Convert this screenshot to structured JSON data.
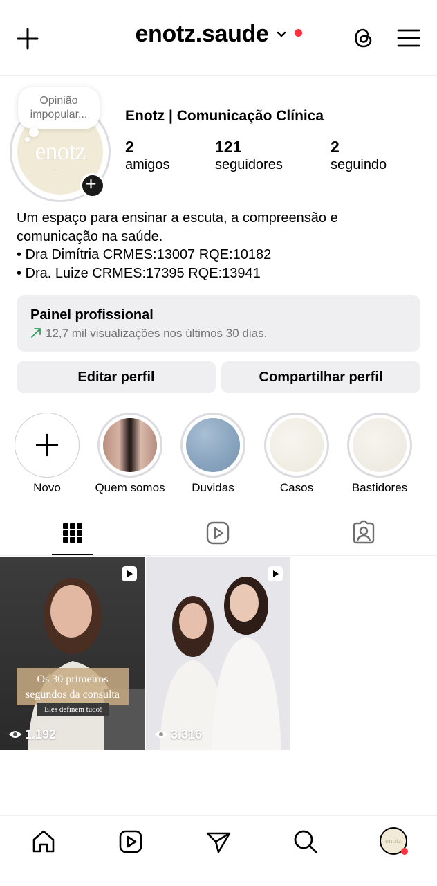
{
  "header": {
    "username": "enotz.saude",
    "icons": [
      "plus-icon",
      "chevron-down-icon",
      "threads-icon",
      "menu-icon"
    ],
    "notification_color": "#ff3040"
  },
  "profile": {
    "note": "Opinião impopular...",
    "avatar_text": "enotz",
    "display_name": "Enotz | Comunicação Clínica",
    "stats": [
      {
        "value": "2",
        "label": "amigos"
      },
      {
        "value": "121",
        "label": "seguidores"
      },
      {
        "value": "2",
        "label": "seguindo"
      }
    ],
    "bio": [
      "Um espaço para ensinar a escuta, a compreensão e",
      "comunicação na saúde.",
      "• Dra Dimítria CRMES:13007 RQE:10182",
      "• Dra. Luize CRMES:17395 RQE:13941"
    ]
  },
  "dashboard": {
    "title": "Painel profissional",
    "subtitle": "12,7 mil visualizações nos últimos 30 dias.",
    "trend_color": "#2e9e5b"
  },
  "actions": {
    "edit": "Editar perfil",
    "share": "Compartilhar perfil"
  },
  "highlights": [
    {
      "label": "Novo"
    },
    {
      "label": "Quem somos"
    },
    {
      "label": "Duvidas"
    },
    {
      "label": "Casos"
    },
    {
      "label": "Bastidores"
    }
  ],
  "tabs": [
    "grid-icon",
    "reels-icon",
    "tagged-icon"
  ],
  "posts": [
    {
      "views": "1.192",
      "caption": "Os 30 primeiros segundos da consulta",
      "tag": "Eles definem tudo!"
    },
    {
      "views": "3.316"
    }
  ],
  "bottom_nav": [
    "home-icon",
    "reels-icon",
    "direct-icon",
    "search-icon",
    "profile-avatar"
  ]
}
